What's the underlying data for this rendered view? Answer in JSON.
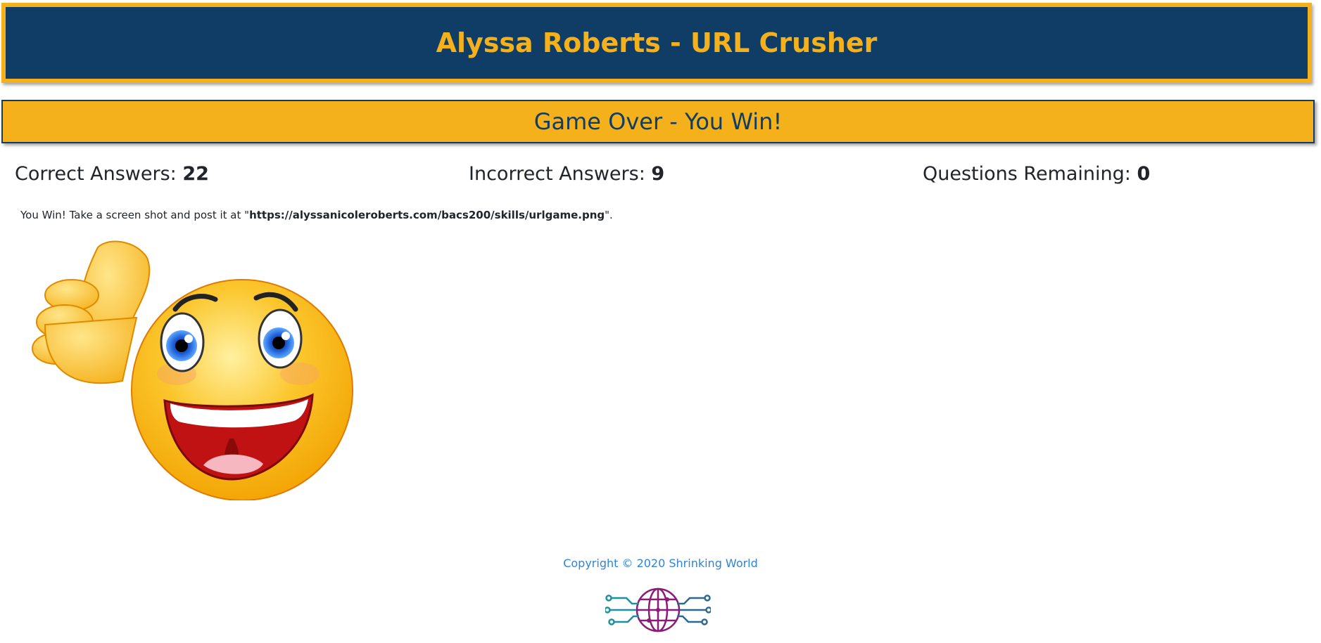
{
  "header": {
    "title": "Alyssa Roberts - URL Crusher"
  },
  "banner": {
    "text": "Game Over - You Win!"
  },
  "stats": {
    "correct_label": "Correct Answers: ",
    "correct_value": "22",
    "incorrect_label": "Incorrect Answers: ",
    "incorrect_value": "9",
    "remaining_label": "Questions Remaining: ",
    "remaining_value": "0"
  },
  "message": {
    "prefix": "You Win! Take a screen shot and post it at \"",
    "url": "https://alyssanicoleroberts.com/bacs200/skills/urlgame.png",
    "suffix": "\"."
  },
  "images": {
    "smiley_icon": "thumbs-up-smiley-icon",
    "logo_icon": "globe-circuit-logo-icon"
  },
  "footer": {
    "copyright": "Copyright © 2020 Shrinking World"
  },
  "colors": {
    "header_bg": "#0f3d65",
    "accent": "#f5b11c",
    "link": "#2f84db"
  }
}
